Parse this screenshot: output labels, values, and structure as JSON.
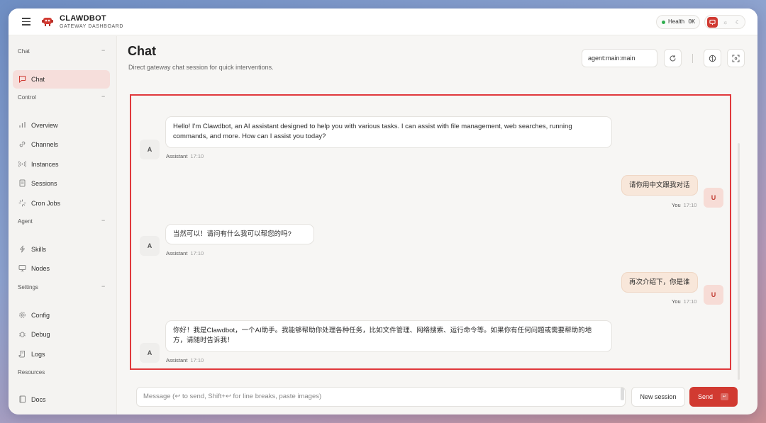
{
  "header": {
    "brand_title": "CLAWDBOT",
    "brand_subtitle": "GATEWAY DASHBOARD",
    "health_label": "Health",
    "health_status": "OK",
    "accent_color": "#d13a31"
  },
  "sidebar": {
    "sections": [
      {
        "title": "Chat",
        "items": [
          {
            "label": "Chat",
            "icon": "message-square-icon"
          }
        ]
      },
      {
        "title": "Control",
        "items": [
          {
            "label": "Overview",
            "icon": "bar-chart-icon"
          },
          {
            "label": "Channels",
            "icon": "link-icon"
          },
          {
            "label": "Instances",
            "icon": "radio-icon"
          },
          {
            "label": "Sessions",
            "icon": "file-text-icon"
          },
          {
            "label": "Cron Jobs",
            "icon": "loader-icon"
          }
        ]
      },
      {
        "title": "Agent",
        "items": [
          {
            "label": "Skills",
            "icon": "zap-icon"
          },
          {
            "label": "Nodes",
            "icon": "monitor-icon"
          }
        ]
      },
      {
        "title": "Settings",
        "items": [
          {
            "label": "Config",
            "icon": "settings-icon"
          },
          {
            "label": "Debug",
            "icon": "bug-icon"
          },
          {
            "label": "Logs",
            "icon": "scroll-icon"
          }
        ]
      },
      {
        "title": "Resources",
        "items": [
          {
            "label": "Docs",
            "icon": "book-icon"
          }
        ]
      }
    ]
  },
  "main": {
    "title": "Chat",
    "subtitle": "Direct gateway chat session for quick interventions.",
    "session_key": "agent:main:main"
  },
  "messages": [
    {
      "role": "assistant",
      "avatar": "A",
      "sender": "Assistant",
      "time": "17:10",
      "text": "Hello! I'm Clawdbot, an AI assistant designed to help you with various tasks. I can assist with file management, web searches, running commands, and more. How can I assist you today?"
    },
    {
      "role": "user",
      "avatar": "U",
      "sender": "You",
      "time": "17:10",
      "text": "请你用中文跟我对话"
    },
    {
      "role": "assistant",
      "avatar": "A",
      "sender": "Assistant",
      "time": "17:10",
      "text": "当然可以！请问有什么我可以帮您的吗?"
    },
    {
      "role": "user",
      "avatar": "U",
      "sender": "You",
      "time": "17:10",
      "text": "再次介绍下，你是谁"
    },
    {
      "role": "assistant",
      "avatar": "A",
      "sender": "Assistant",
      "time": "17:10",
      "text": "你好！我是Clawdbot，一个AI助手。我能够帮助你处理各种任务，比如文件管理、网络搜索、运行命令等。如果你有任何问题或需要帮助的地方，请随时告诉我！"
    }
  ],
  "composer": {
    "placeholder": "Message (↩ to send, Shift+↩ for line breaks, paste images)",
    "new_session_label": "New session",
    "send_label": "Send",
    "send_shortcut": "↵"
  }
}
